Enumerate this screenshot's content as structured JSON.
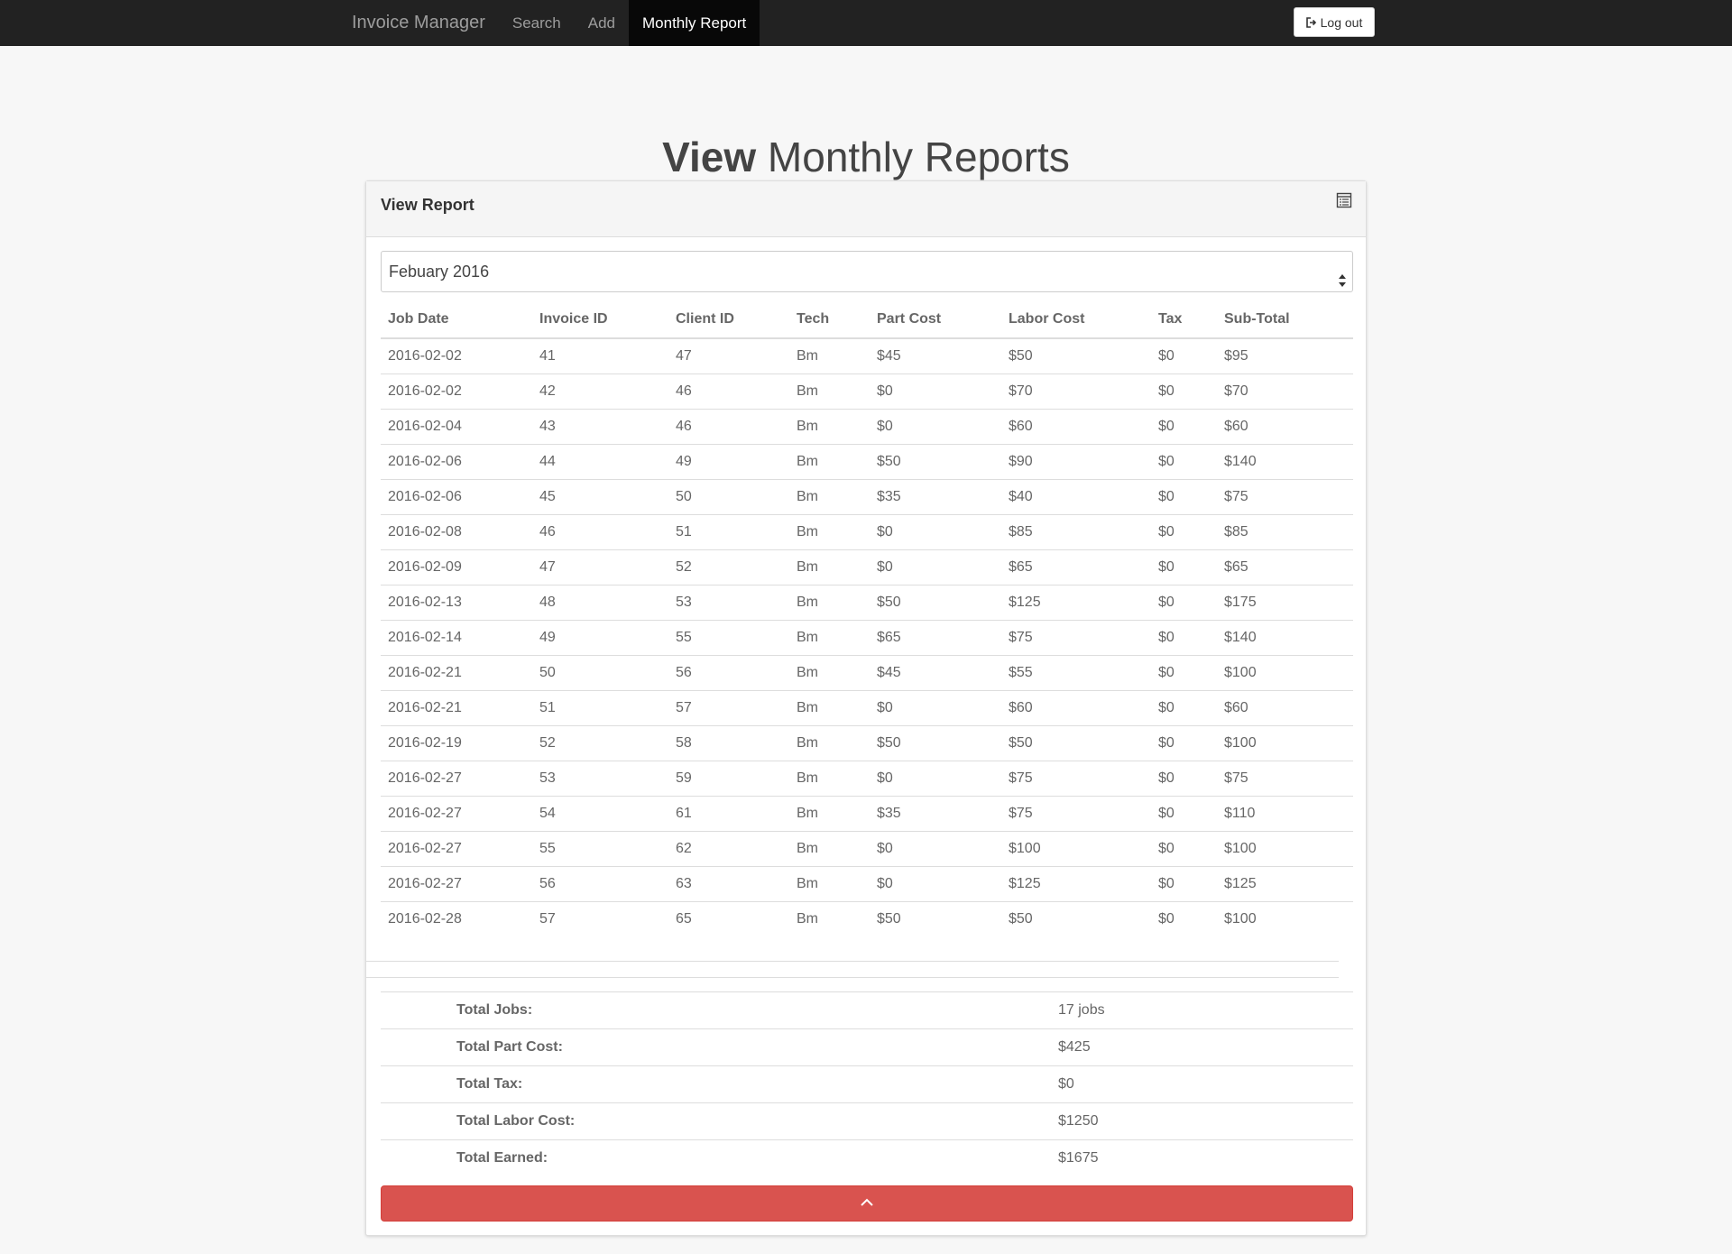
{
  "nav": {
    "brand": "Invoice Manager",
    "links": [
      {
        "label": "Search"
      },
      {
        "label": "Add"
      },
      {
        "label": "Monthly Report"
      }
    ],
    "logout_label": "Log out"
  },
  "page": {
    "title_bold": "View",
    "title_rest": "Monthly Reports"
  },
  "panel": {
    "title": "View Report",
    "month_select": "Febuary 2016"
  },
  "table": {
    "headers": [
      "Job Date",
      "Invoice ID",
      "Client ID",
      "Tech",
      "Part Cost",
      "Labor Cost",
      "Tax",
      "Sub-Total"
    ],
    "rows": [
      [
        "2016-02-02",
        "41",
        "47",
        "Bm",
        "$45",
        "$50",
        "$0",
        "$95"
      ],
      [
        "2016-02-02",
        "42",
        "46",
        "Bm",
        "$0",
        "$70",
        "$0",
        "$70"
      ],
      [
        "2016-02-04",
        "43",
        "46",
        "Bm",
        "$0",
        "$60",
        "$0",
        "$60"
      ],
      [
        "2016-02-06",
        "44",
        "49",
        "Bm",
        "$50",
        "$90",
        "$0",
        "$140"
      ],
      [
        "2016-02-06",
        "45",
        "50",
        "Bm",
        "$35",
        "$40",
        "$0",
        "$75"
      ],
      [
        "2016-02-08",
        "46",
        "51",
        "Bm",
        "$0",
        "$85",
        "$0",
        "$85"
      ],
      [
        "2016-02-09",
        "47",
        "52",
        "Bm",
        "$0",
        "$65",
        "$0",
        "$65"
      ],
      [
        "2016-02-13",
        "48",
        "53",
        "Bm",
        "$50",
        "$125",
        "$0",
        "$175"
      ],
      [
        "2016-02-14",
        "49",
        "55",
        "Bm",
        "$65",
        "$75",
        "$0",
        "$140"
      ],
      [
        "2016-02-21",
        "50",
        "56",
        "Bm",
        "$45",
        "$55",
        "$0",
        "$100"
      ],
      [
        "2016-02-21",
        "51",
        "57",
        "Bm",
        "$0",
        "$60",
        "$0",
        "$60"
      ],
      [
        "2016-02-19",
        "52",
        "58",
        "Bm",
        "$50",
        "$50",
        "$0",
        "$100"
      ],
      [
        "2016-02-27",
        "53",
        "59",
        "Bm",
        "$0",
        "$75",
        "$0",
        "$75"
      ],
      [
        "2016-02-27",
        "54",
        "61",
        "Bm",
        "$35",
        "$75",
        "$0",
        "$110"
      ],
      [
        "2016-02-27",
        "55",
        "62",
        "Bm",
        "$0",
        "$100",
        "$0",
        "$100"
      ],
      [
        "2016-02-27",
        "56",
        "63",
        "Bm",
        "$0",
        "$125",
        "$0",
        "$125"
      ],
      [
        "2016-02-28",
        "57",
        "65",
        "Bm",
        "$50",
        "$50",
        "$0",
        "$100"
      ]
    ]
  },
  "totals": [
    {
      "label": "Total Jobs:",
      "value": "17 jobs"
    },
    {
      "label": "Total Part Cost:",
      "value": "$425"
    },
    {
      "label": "Total Tax:",
      "value": "$0"
    },
    {
      "label": "Total Labor Cost:",
      "value": "$1250"
    },
    {
      "label": "Total Earned:",
      "value": "$1675"
    }
  ],
  "colors": {
    "navbar": "#222222",
    "danger": "#d9534f"
  },
  "icons": {
    "logout": "sign-out-icon",
    "panel": "list-alt-icon",
    "collapse": "chevron-up-icon"
  }
}
